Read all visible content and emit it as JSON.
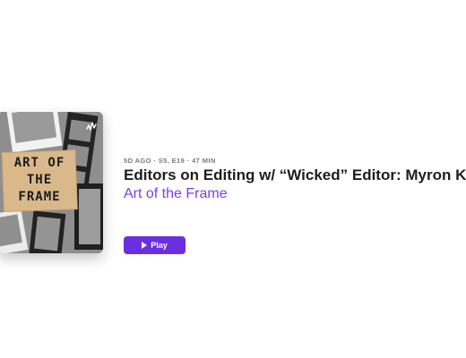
{
  "episode": {
    "meta": "5D AGO · S5, E19 · 47 MIN",
    "title": "Editors on Editing w/ “Wicked” Editor: Myron Kerstein",
    "show": "Art of the Frame",
    "play_label": "Play"
  },
  "artwork": {
    "title_lines": [
      "ART OF",
      "THE",
      "FRAME"
    ],
    "badge_icon": "podcast-waves-icon"
  },
  "colors": {
    "accent": "#6a2fe0",
    "show_link": "#7d3ce6",
    "meta": "#7a7a7e",
    "title": "#1d1d1f"
  }
}
